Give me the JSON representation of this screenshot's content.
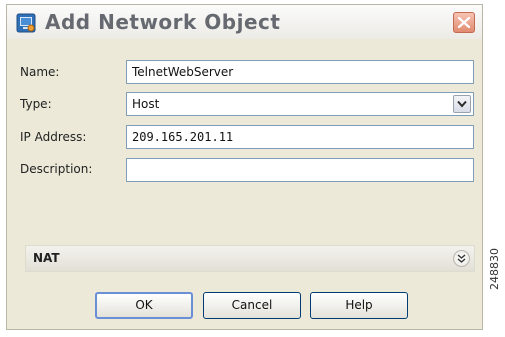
{
  "window": {
    "title": "Add Network Object",
    "app_icon": "network-object-icon",
    "close_icon": "close-icon"
  },
  "form": {
    "name": {
      "label": "Name:",
      "value": "TelnetWebServer"
    },
    "type": {
      "label": "Type:",
      "value": "Host",
      "dropdown_icon": "chevron-down-icon"
    },
    "ip_address": {
      "label": "IP Address:",
      "value": "209.165.201.11"
    },
    "description": {
      "label": "Description:",
      "value": ""
    }
  },
  "nat": {
    "label": "NAT",
    "expand_icon": "double-chevron-down-icon"
  },
  "buttons": {
    "ok": "OK",
    "cancel": "Cancel",
    "help": "Help"
  },
  "figure_id": "248830",
  "colors": {
    "dialog_bg": "#ece9d8",
    "title_text": "#666a70",
    "close_button": "#e08b70",
    "field_border": "#7f9db9",
    "default_button_border": "#6b8fd6"
  }
}
